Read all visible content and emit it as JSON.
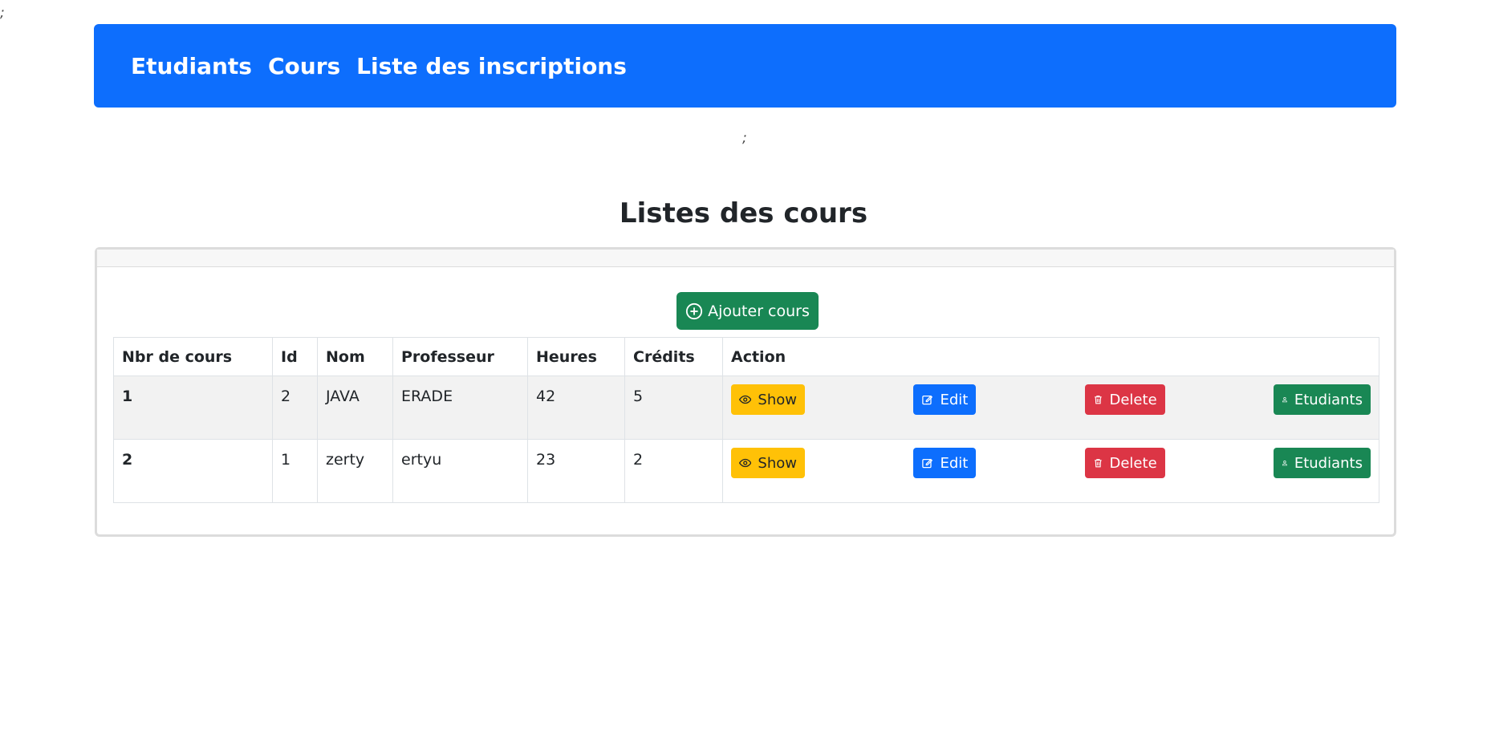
{
  "page": {
    "stray_top": ";",
    "stray_mid": ";",
    "title": "Listes des cours"
  },
  "nav": {
    "items": [
      "Etudiants",
      "Cours",
      "Liste des inscriptions"
    ]
  },
  "colors": {
    "primary": "#0d6efd",
    "success": "#198754",
    "warning": "#ffc107",
    "danger": "#dc3545"
  },
  "add_button": {
    "label": "Ajouter cours",
    "icon": "plus-circle-icon"
  },
  "table": {
    "headers": [
      "Nbr de cours",
      "Id",
      "Nom",
      "Professeur",
      "Heures",
      "Crédits",
      "Action"
    ],
    "rows": [
      {
        "nbr": "1",
        "id": "2",
        "nom": "JAVA",
        "professeur": "ERADE",
        "heures": "42",
        "credits": "5"
      },
      {
        "nbr": "2",
        "id": "1",
        "nom": "zerty",
        "professeur": "ertyu",
        "heures": "23",
        "credits": "2"
      }
    ],
    "actions": {
      "show": "Show",
      "edit": "Edit",
      "delete": "Delete",
      "etudiants": "Etudiants"
    }
  }
}
